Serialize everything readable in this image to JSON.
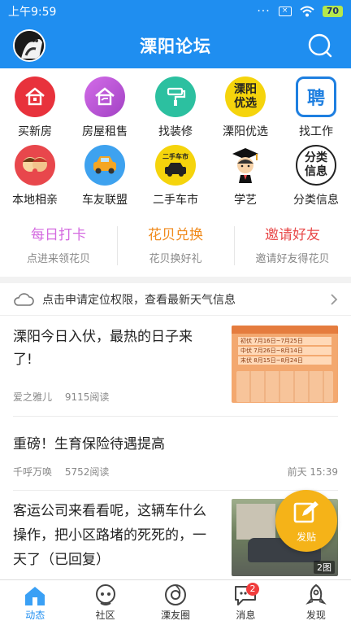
{
  "status_bar": {
    "time": "上午9:59",
    "battery": "70"
  },
  "header": {
    "title": "溧阳论坛"
  },
  "grid": [
    {
      "label": "买新房",
      "icon": "house-icon",
      "color": "#e8323c"
    },
    {
      "label": "房屋租售",
      "icon": "rental-house-icon",
      "color": "#b552d0"
    },
    {
      "label": "找装修",
      "icon": "paint-roller-icon",
      "color": "#2cc0a0"
    },
    {
      "label": "溧阳优选",
      "icon": "liyang-select-icon",
      "icon_text_1": "溧阳",
      "icon_text_2": "优选",
      "color": "#f5d40c"
    },
    {
      "label": "找工作",
      "icon": "recruit-icon",
      "icon_text_1": "聘",
      "color": "#1e7fe0"
    },
    {
      "label": "本地相亲",
      "icon": "couple-icon",
      "color": "#e8474c"
    },
    {
      "label": "车友联盟",
      "icon": "car-icon",
      "color": "#3ea2ef"
    },
    {
      "label": "二手车市",
      "icon": "used-car-icon",
      "icon_text_1": "二手车市",
      "color": "#f5d40c"
    },
    {
      "label": "学艺",
      "icon": "graduate-icon",
      "color": "#f0b430"
    },
    {
      "label": "分类信息",
      "icon": "classified-info-icon",
      "icon_text_1": "分类",
      "icon_text_2": "信息",
      "color": "#222222"
    }
  ],
  "actions": [
    {
      "title": "每日打卡",
      "subtitle": "点进来领花贝",
      "color": "#d46be0"
    },
    {
      "title": "花贝兑换",
      "subtitle": "花贝换好礼",
      "color": "#f08a1c"
    },
    {
      "title": "邀请好友",
      "subtitle": "邀请好友得花贝",
      "color": "#e84a4a"
    }
  ],
  "weather": {
    "text": "点击申请定位权限，查看最新天气信息"
  },
  "posts": [
    {
      "title_line1": "溧阳今日入伏，最热的日子来",
      "title_line2": "了!",
      "author": "爱之雅儿",
      "reads": "9115阅读",
      "thumb": {
        "rows": [
          {
            "label": "初伏",
            "dates": "7月16日~7月25日"
          },
          {
            "label": "中伏",
            "dates": "7月26日~8月14日"
          },
          {
            "label": "末伏",
            "dates": "8月15日~8月24日"
          }
        ]
      }
    },
    {
      "title_line1": "重磅！生育保险待遇提高",
      "author": "千呼万唤",
      "reads": "5752阅读",
      "date": "前天 15:39"
    },
    {
      "title_line1": "客运公司来看看呢，这辆车什么",
      "title_line2": "操作，把小区路堵的死死的，一",
      "title_line3": "天了（已回复）",
      "image_count": "2图"
    }
  ],
  "fab": {
    "label": "发贴"
  },
  "tabs": [
    {
      "label": "动态",
      "icon": "home-icon",
      "active": true
    },
    {
      "label": "社区",
      "icon": "community-icon",
      "active": false
    },
    {
      "label": "溧友圈",
      "icon": "friends-circle-icon",
      "active": false
    },
    {
      "label": "消息",
      "icon": "message-icon",
      "active": false,
      "badge": "2"
    },
    {
      "label": "发现",
      "icon": "rocket-icon",
      "active": false
    }
  ]
}
